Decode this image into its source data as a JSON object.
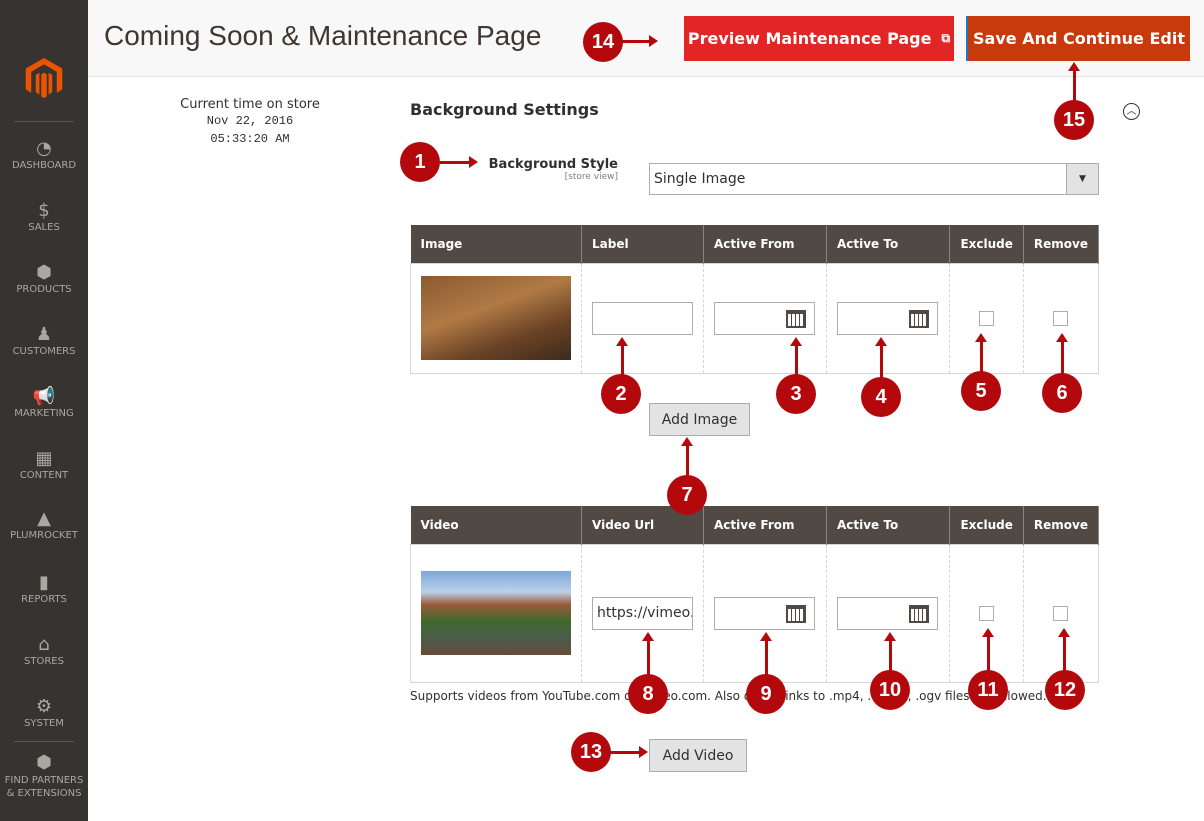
{
  "sidebar": {
    "items": [
      {
        "label": "DASHBOARD",
        "icon": "gauge-icon"
      },
      {
        "label": "SALES",
        "icon": "dollar-icon"
      },
      {
        "label": "PRODUCTS",
        "icon": "box-icon"
      },
      {
        "label": "CUSTOMERS",
        "icon": "person-icon"
      },
      {
        "label": "MARKETING",
        "icon": "megaphone-icon"
      },
      {
        "label": "CONTENT",
        "icon": "layout-icon"
      },
      {
        "label": "PLUMROCKET",
        "icon": "plumrocket-icon"
      },
      {
        "label": "REPORTS",
        "icon": "bar-chart-icon"
      },
      {
        "label": "STORES",
        "icon": "store-icon"
      },
      {
        "label": "SYSTEM",
        "icon": "gear-icon"
      },
      {
        "label": "FIND PARTNERS & EXTENSIONS",
        "icon": "cube-icon"
      }
    ]
  },
  "header": {
    "title": "Coming Soon & Maintenance Page",
    "preview_label": "Preview Maintenance Page",
    "save_label": "Save And Continue Edit"
  },
  "store_time": {
    "label": "Current time on store",
    "date": "Nov 22, 2016",
    "time": "05:33:20 AM"
  },
  "section": {
    "title": "Background Settings",
    "style_label": "Background Style",
    "scope": "[store view]",
    "style_value": "Single Image"
  },
  "image_table": {
    "headers": [
      "Image",
      "Label",
      "Active From",
      "Active To",
      "Exclude",
      "Remove"
    ],
    "label_value": "",
    "add_label": "Add Image"
  },
  "video_table": {
    "headers": [
      "Video",
      "Video Url",
      "Active From",
      "Active To",
      "Exclude",
      "Remove"
    ],
    "url_value": "https://vimeo.",
    "add_label": "Add Video",
    "note": "Supports videos from YouTube.com or Vimeo.com. Also direct links to .mp4, .webm, .ogv files are allowed."
  },
  "markers": [
    "1",
    "2",
    "3",
    "4",
    "5",
    "6",
    "7",
    "8",
    "9",
    "10",
    "11",
    "12",
    "13",
    "14",
    "15"
  ],
  "colors": {
    "sidebar": "#373330",
    "preview": "#e22626",
    "save": "#c83a0c",
    "table_header": "#514943",
    "marker": "#b3090c",
    "logo": "#eb5202"
  }
}
